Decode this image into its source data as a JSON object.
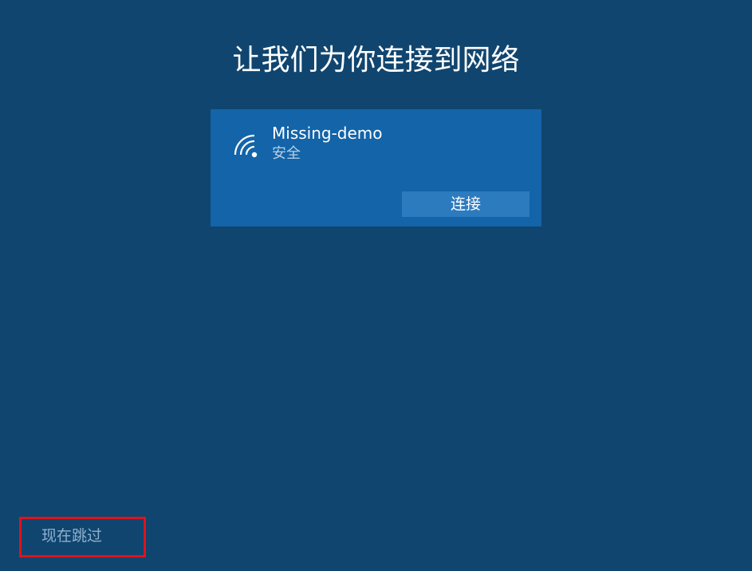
{
  "page": {
    "title": "让我们为你连接到网络"
  },
  "network": {
    "name": "Missing-demo",
    "security": "安全",
    "icon": "wifi-icon",
    "connect_label": "连接"
  },
  "footer": {
    "skip_label": "现在跳过"
  },
  "colors": {
    "background": "#10456f",
    "card": "#1364a8",
    "button": "#2d7bbf",
    "highlight_outline": "#e0121b"
  }
}
